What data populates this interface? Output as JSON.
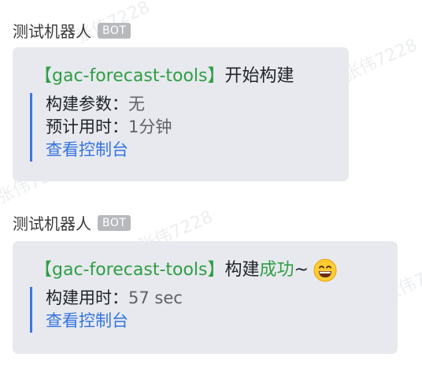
{
  "watermark": "张伟7228",
  "messages": [
    {
      "sender": "测试机器人",
      "badge": "BOT",
      "title_project": "【gac-forecast-tools】",
      "title_action": "开始构建",
      "fields": [
        {
          "label": "构建参数：",
          "value": "无"
        },
        {
          "label": "预计用时：",
          "value": "1分钟"
        }
      ],
      "link": "查看控制台"
    },
    {
      "sender": "测试机器人",
      "badge": "BOT",
      "title_project": "【gac-forecast-tools】",
      "title_action": "构建",
      "title_status": "成功",
      "title_suffix": "~",
      "title_emoji": "grinning-face-icon",
      "fields": [
        {
          "label": "构建用时：",
          "value": "57 sec"
        }
      ],
      "link": "查看控制台"
    }
  ],
  "colors": {
    "project": "#2f9e44",
    "status": "#2f9e44",
    "link": "#3574e0",
    "quote_bar": "#3b78e0",
    "card_bg": "#e7e9ee",
    "badge_bg": "#b7b9bd"
  }
}
